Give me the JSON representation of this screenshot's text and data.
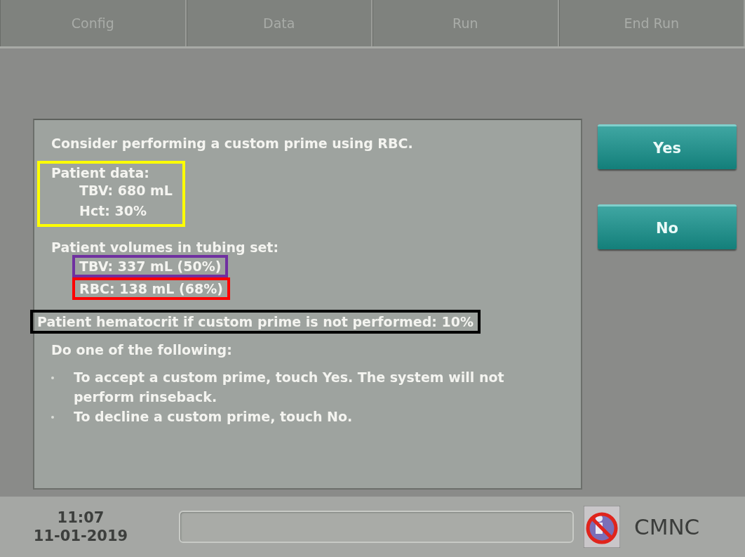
{
  "tabs": [
    {
      "label": "Config",
      "disabled": true
    },
    {
      "label": "Data",
      "disabled": true
    },
    {
      "label": "Run",
      "disabled": true
    },
    {
      "label": "End Run",
      "disabled": true
    }
  ],
  "message": {
    "intro": "Consider performing a custom prime using RBC.",
    "patient_data": {
      "heading": "Patient data:",
      "lines": [
        "TBV: 680 mL",
        "Hct: 30%"
      ],
      "color": "#ffff00"
    },
    "volumes": {
      "heading": "Patient volumes in tubing set:",
      "lines": [
        {
          "text": "TBV: 337 mL (50%)",
          "color": "#7030a0"
        },
        {
          "text": "RBC: 138 mL (68%)",
          "color": "#ff0000"
        }
      ]
    },
    "hematocrit": {
      "text": "Patient hematocrit if custom prime is not performed: 10%",
      "color": "#000000"
    },
    "instruction": "Do one of the following:",
    "bullets": [
      "To accept a custom prime, touch Yes. The system will not perform rinseback.",
      "To decline a custom prime, touch No."
    ]
  },
  "buttons": [
    "Yes",
    "No"
  ],
  "status_bar": {
    "time": "11:07",
    "date": "11-01-2019",
    "mode": "CMNC"
  }
}
